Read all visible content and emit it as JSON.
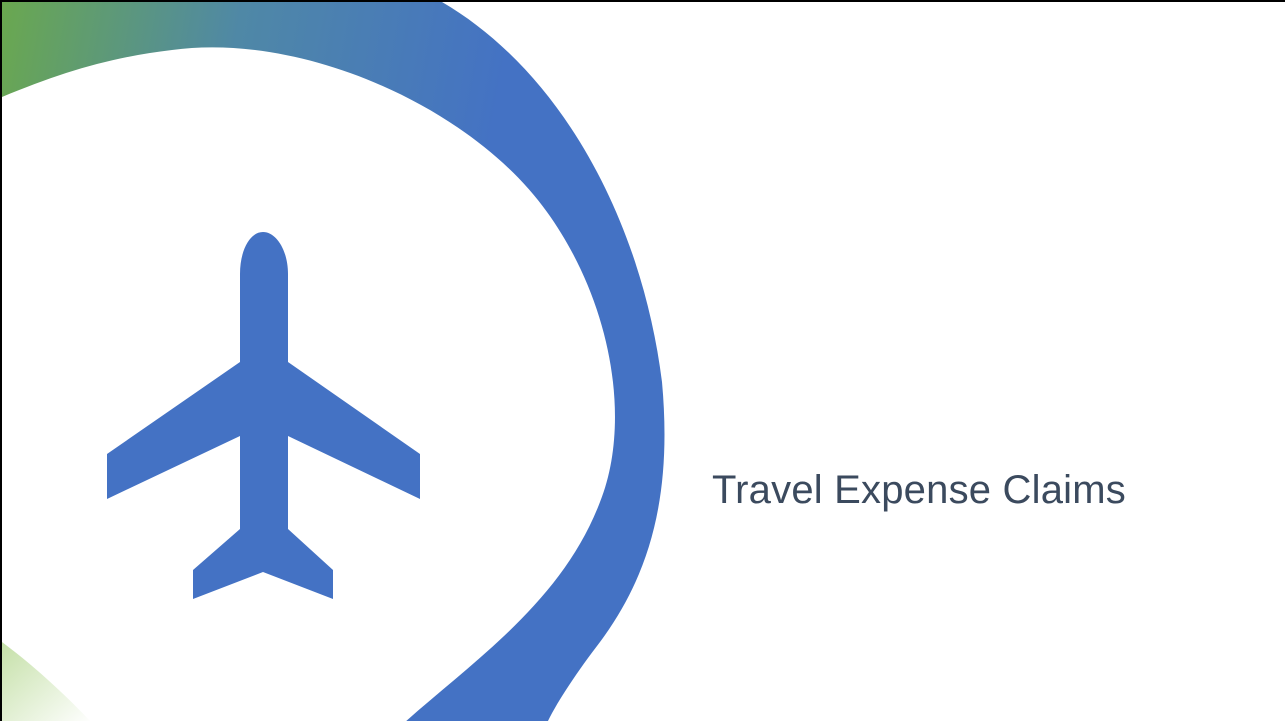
{
  "slide": {
    "title": "Travel Expense Claims"
  },
  "icons": {
    "hero": "airplane-icon"
  },
  "colors": {
    "background": "#ffffff",
    "title_text": "#3b4a5e",
    "airplane_fill": "#4472c4",
    "ring_gradient_start": "#6aa84f",
    "ring_gradient_end": "#4472c4"
  }
}
